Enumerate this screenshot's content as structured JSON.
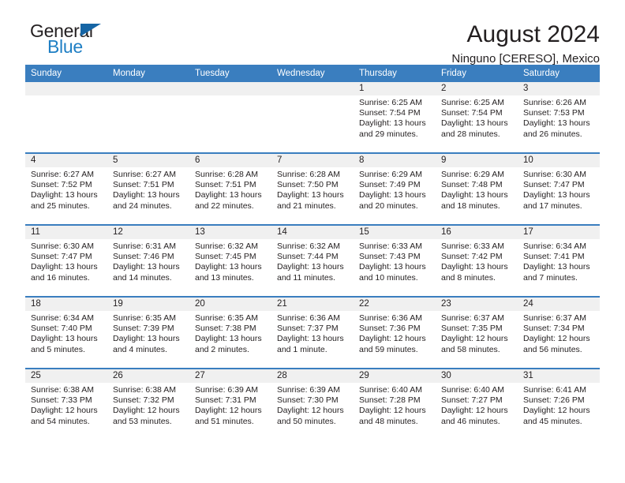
{
  "brand": {
    "name_part1": "General",
    "name_part2": "Blue",
    "colors": {
      "black": "#231f20",
      "blue": "#1f7fc4",
      "triangle": "#1565a5"
    }
  },
  "header": {
    "title": "August 2024",
    "subtitle": "Ninguno [CERESO], Mexico"
  },
  "calendar": {
    "accent_color": "#3a7ebf",
    "daynum_band_color": "#f0f0f0",
    "weekday_headers": [
      "Sunday",
      "Monday",
      "Tuesday",
      "Wednesday",
      "Thursday",
      "Friday",
      "Saturday"
    ],
    "weeks": [
      [
        {
          "day": "",
          "empty": true,
          "sunrise": "",
          "sunset": "",
          "daylight_line1": "",
          "daylight_line2": ""
        },
        {
          "day": "",
          "empty": true,
          "sunrise": "",
          "sunset": "",
          "daylight_line1": "",
          "daylight_line2": ""
        },
        {
          "day": "",
          "empty": true,
          "sunrise": "",
          "sunset": "",
          "daylight_line1": "",
          "daylight_line2": ""
        },
        {
          "day": "",
          "empty": true,
          "sunrise": "",
          "sunset": "",
          "daylight_line1": "",
          "daylight_line2": ""
        },
        {
          "day": "1",
          "empty": false,
          "sunrise": "Sunrise: 6:25 AM",
          "sunset": "Sunset: 7:54 PM",
          "daylight_line1": "Daylight: 13 hours",
          "daylight_line2": "and 29 minutes."
        },
        {
          "day": "2",
          "empty": false,
          "sunrise": "Sunrise: 6:25 AM",
          "sunset": "Sunset: 7:54 PM",
          "daylight_line1": "Daylight: 13 hours",
          "daylight_line2": "and 28 minutes."
        },
        {
          "day": "3",
          "empty": false,
          "sunrise": "Sunrise: 6:26 AM",
          "sunset": "Sunset: 7:53 PM",
          "daylight_line1": "Daylight: 13 hours",
          "daylight_line2": "and 26 minutes."
        }
      ],
      [
        {
          "day": "4",
          "empty": false,
          "sunrise": "Sunrise: 6:27 AM",
          "sunset": "Sunset: 7:52 PM",
          "daylight_line1": "Daylight: 13 hours",
          "daylight_line2": "and 25 minutes."
        },
        {
          "day": "5",
          "empty": false,
          "sunrise": "Sunrise: 6:27 AM",
          "sunset": "Sunset: 7:51 PM",
          "daylight_line1": "Daylight: 13 hours",
          "daylight_line2": "and 24 minutes."
        },
        {
          "day": "6",
          "empty": false,
          "sunrise": "Sunrise: 6:28 AM",
          "sunset": "Sunset: 7:51 PM",
          "daylight_line1": "Daylight: 13 hours",
          "daylight_line2": "and 22 minutes."
        },
        {
          "day": "7",
          "empty": false,
          "sunrise": "Sunrise: 6:28 AM",
          "sunset": "Sunset: 7:50 PM",
          "daylight_line1": "Daylight: 13 hours",
          "daylight_line2": "and 21 minutes."
        },
        {
          "day": "8",
          "empty": false,
          "sunrise": "Sunrise: 6:29 AM",
          "sunset": "Sunset: 7:49 PM",
          "daylight_line1": "Daylight: 13 hours",
          "daylight_line2": "and 20 minutes."
        },
        {
          "day": "9",
          "empty": false,
          "sunrise": "Sunrise: 6:29 AM",
          "sunset": "Sunset: 7:48 PM",
          "daylight_line1": "Daylight: 13 hours",
          "daylight_line2": "and 18 minutes."
        },
        {
          "day": "10",
          "empty": false,
          "sunrise": "Sunrise: 6:30 AM",
          "sunset": "Sunset: 7:47 PM",
          "daylight_line1": "Daylight: 13 hours",
          "daylight_line2": "and 17 minutes."
        }
      ],
      [
        {
          "day": "11",
          "empty": false,
          "sunrise": "Sunrise: 6:30 AM",
          "sunset": "Sunset: 7:47 PM",
          "daylight_line1": "Daylight: 13 hours",
          "daylight_line2": "and 16 minutes."
        },
        {
          "day": "12",
          "empty": false,
          "sunrise": "Sunrise: 6:31 AM",
          "sunset": "Sunset: 7:46 PM",
          "daylight_line1": "Daylight: 13 hours",
          "daylight_line2": "and 14 minutes."
        },
        {
          "day": "13",
          "empty": false,
          "sunrise": "Sunrise: 6:32 AM",
          "sunset": "Sunset: 7:45 PM",
          "daylight_line1": "Daylight: 13 hours",
          "daylight_line2": "and 13 minutes."
        },
        {
          "day": "14",
          "empty": false,
          "sunrise": "Sunrise: 6:32 AM",
          "sunset": "Sunset: 7:44 PM",
          "daylight_line1": "Daylight: 13 hours",
          "daylight_line2": "and 11 minutes."
        },
        {
          "day": "15",
          "empty": false,
          "sunrise": "Sunrise: 6:33 AM",
          "sunset": "Sunset: 7:43 PM",
          "daylight_line1": "Daylight: 13 hours",
          "daylight_line2": "and 10 minutes."
        },
        {
          "day": "16",
          "empty": false,
          "sunrise": "Sunrise: 6:33 AM",
          "sunset": "Sunset: 7:42 PM",
          "daylight_line1": "Daylight: 13 hours",
          "daylight_line2": "and 8 minutes."
        },
        {
          "day": "17",
          "empty": false,
          "sunrise": "Sunrise: 6:34 AM",
          "sunset": "Sunset: 7:41 PM",
          "daylight_line1": "Daylight: 13 hours",
          "daylight_line2": "and 7 minutes."
        }
      ],
      [
        {
          "day": "18",
          "empty": false,
          "sunrise": "Sunrise: 6:34 AM",
          "sunset": "Sunset: 7:40 PM",
          "daylight_line1": "Daylight: 13 hours",
          "daylight_line2": "and 5 minutes."
        },
        {
          "day": "19",
          "empty": false,
          "sunrise": "Sunrise: 6:35 AM",
          "sunset": "Sunset: 7:39 PM",
          "daylight_line1": "Daylight: 13 hours",
          "daylight_line2": "and 4 minutes."
        },
        {
          "day": "20",
          "empty": false,
          "sunrise": "Sunrise: 6:35 AM",
          "sunset": "Sunset: 7:38 PM",
          "daylight_line1": "Daylight: 13 hours",
          "daylight_line2": "and 2 minutes."
        },
        {
          "day": "21",
          "empty": false,
          "sunrise": "Sunrise: 6:36 AM",
          "sunset": "Sunset: 7:37 PM",
          "daylight_line1": "Daylight: 13 hours",
          "daylight_line2": "and 1 minute."
        },
        {
          "day": "22",
          "empty": false,
          "sunrise": "Sunrise: 6:36 AM",
          "sunset": "Sunset: 7:36 PM",
          "daylight_line1": "Daylight: 12 hours",
          "daylight_line2": "and 59 minutes."
        },
        {
          "day": "23",
          "empty": false,
          "sunrise": "Sunrise: 6:37 AM",
          "sunset": "Sunset: 7:35 PM",
          "daylight_line1": "Daylight: 12 hours",
          "daylight_line2": "and 58 minutes."
        },
        {
          "day": "24",
          "empty": false,
          "sunrise": "Sunrise: 6:37 AM",
          "sunset": "Sunset: 7:34 PM",
          "daylight_line1": "Daylight: 12 hours",
          "daylight_line2": "and 56 minutes."
        }
      ],
      [
        {
          "day": "25",
          "empty": false,
          "sunrise": "Sunrise: 6:38 AM",
          "sunset": "Sunset: 7:33 PM",
          "daylight_line1": "Daylight: 12 hours",
          "daylight_line2": "and 54 minutes."
        },
        {
          "day": "26",
          "empty": false,
          "sunrise": "Sunrise: 6:38 AM",
          "sunset": "Sunset: 7:32 PM",
          "daylight_line1": "Daylight: 12 hours",
          "daylight_line2": "and 53 minutes."
        },
        {
          "day": "27",
          "empty": false,
          "sunrise": "Sunrise: 6:39 AM",
          "sunset": "Sunset: 7:31 PM",
          "daylight_line1": "Daylight: 12 hours",
          "daylight_line2": "and 51 minutes."
        },
        {
          "day": "28",
          "empty": false,
          "sunrise": "Sunrise: 6:39 AM",
          "sunset": "Sunset: 7:30 PM",
          "daylight_line1": "Daylight: 12 hours",
          "daylight_line2": "and 50 minutes."
        },
        {
          "day": "29",
          "empty": false,
          "sunrise": "Sunrise: 6:40 AM",
          "sunset": "Sunset: 7:28 PM",
          "daylight_line1": "Daylight: 12 hours",
          "daylight_line2": "and 48 minutes."
        },
        {
          "day": "30",
          "empty": false,
          "sunrise": "Sunrise: 6:40 AM",
          "sunset": "Sunset: 7:27 PM",
          "daylight_line1": "Daylight: 12 hours",
          "daylight_line2": "and 46 minutes."
        },
        {
          "day": "31",
          "empty": false,
          "sunrise": "Sunrise: 6:41 AM",
          "sunset": "Sunset: 7:26 PM",
          "daylight_line1": "Daylight: 12 hours",
          "daylight_line2": "and 45 minutes."
        }
      ]
    ]
  }
}
